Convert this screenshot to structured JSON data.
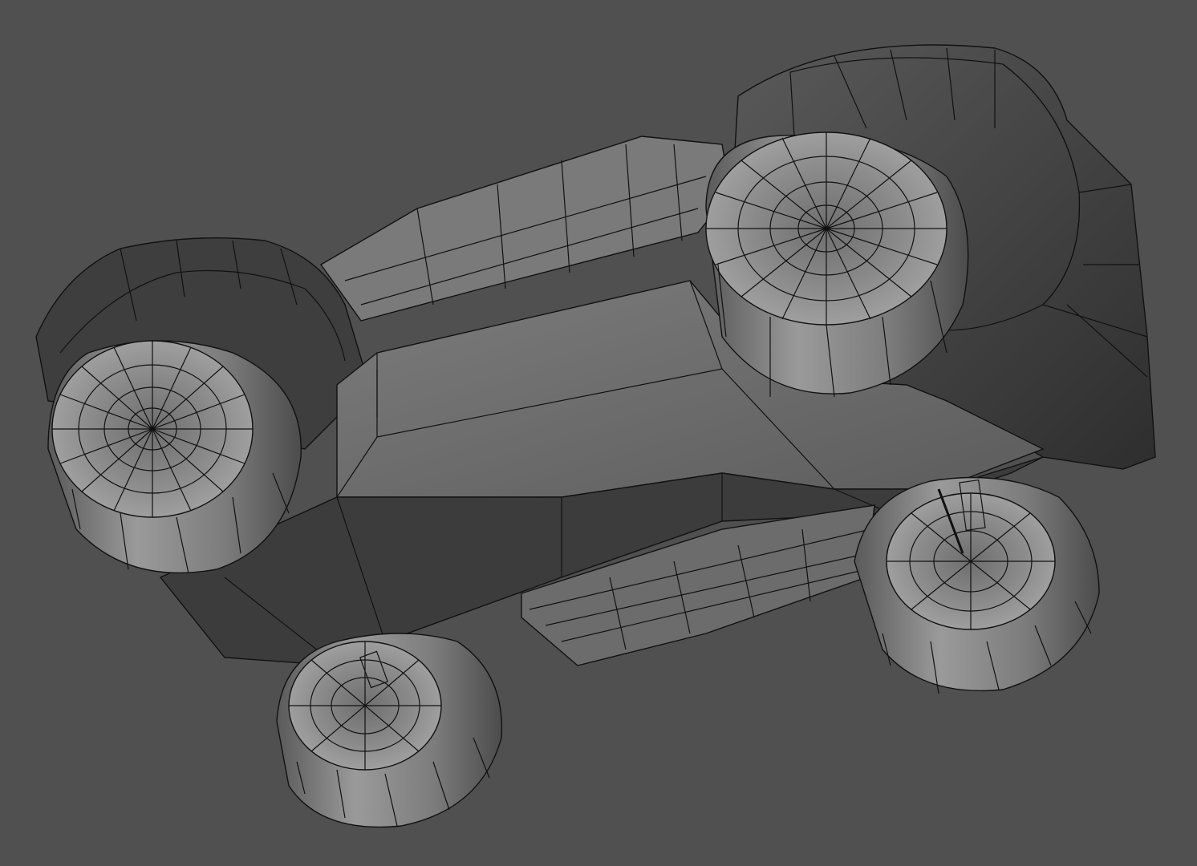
{
  "viewport": {
    "background": "#505050",
    "object": "wireframe-shaded-vehicle-model",
    "shading": "flat-gray-with-wireframe",
    "palette": {
      "body_light": "#8a8a8a",
      "body_mid": "#6a6a6a",
      "body_dark": "#3e3e3e",
      "body_darkest": "#2b2b2b",
      "tire_light": "#9c9c9c",
      "tire_mid": "#777777",
      "tire_dark": "#4a4a4a",
      "wire": "#111111"
    }
  }
}
